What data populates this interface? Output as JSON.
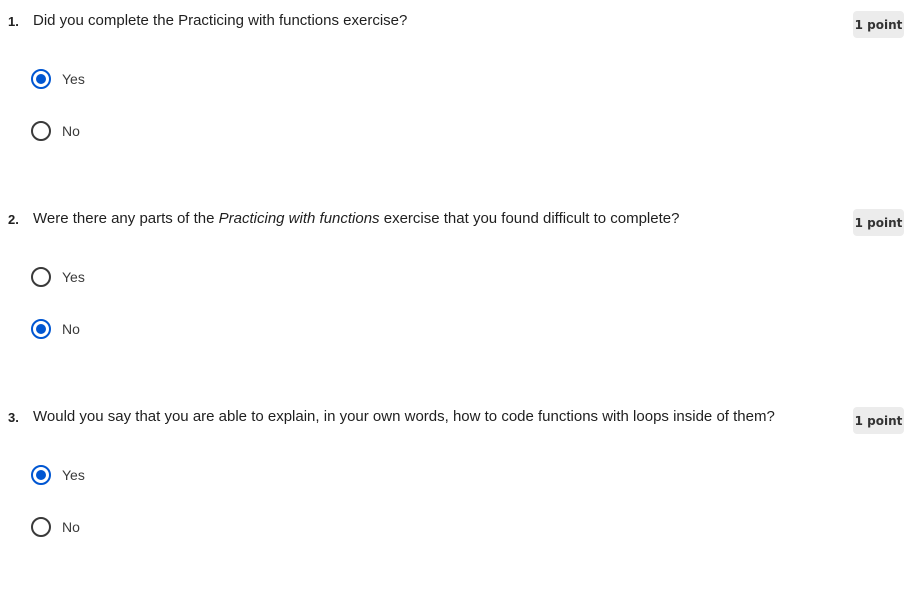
{
  "questions": [
    {
      "number": "1.",
      "text_before": "Did you complete the Practicing with functions exercise?",
      "text_italic": "",
      "text_after": "",
      "points": "1 point",
      "options": [
        {
          "label": "Yes",
          "selected": true
        },
        {
          "label": "No",
          "selected": false
        }
      ]
    },
    {
      "number": "2.",
      "text_before": "Were there any parts of the ",
      "text_italic": "Practicing with functions",
      "text_after": " exercise that you found difficult to complete?",
      "points": "1 point",
      "options": [
        {
          "label": "Yes",
          "selected": false
        },
        {
          "label": "No",
          "selected": true
        }
      ]
    },
    {
      "number": "3.",
      "text_before": "Would you say that you are able to explain, in your own words, how to code functions with loops inside of them?",
      "text_italic": "",
      "text_after": "",
      "points": "1 point",
      "options": [
        {
          "label": "Yes",
          "selected": true
        },
        {
          "label": "No",
          "selected": false
        }
      ]
    }
  ],
  "colors": {
    "accent": "#0056d2",
    "badge_bg": "#ececec",
    "text": "#1f1f1f"
  }
}
